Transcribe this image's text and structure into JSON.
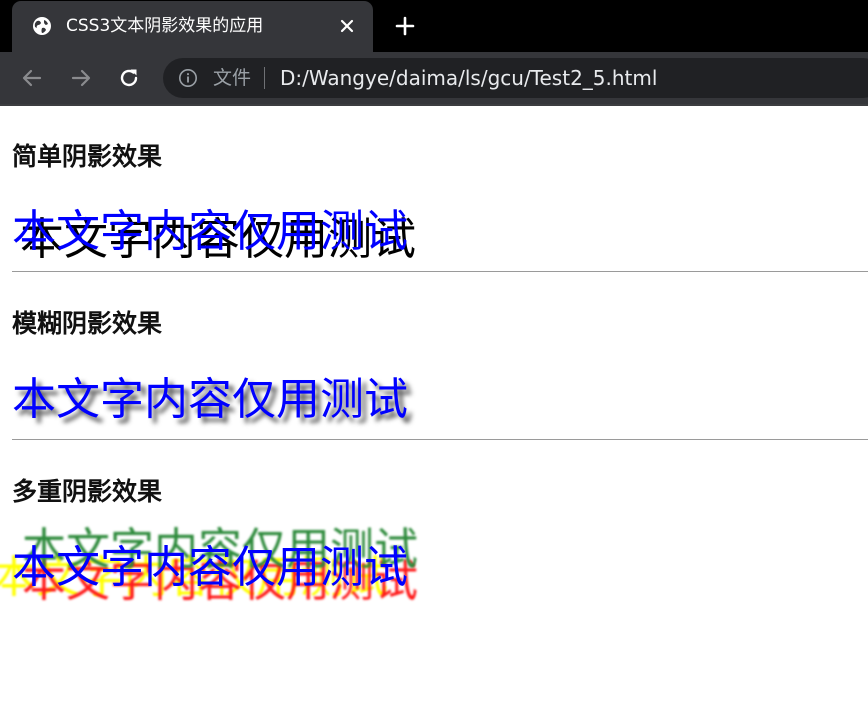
{
  "browser": {
    "tab": {
      "title": "CSS3文本阴影效果的应用",
      "favicon": "globe-icon"
    },
    "address_bar": {
      "scheme_label": "文件",
      "url": "D:/Wangye/daima/ls/gcu/Test2_5.html"
    }
  },
  "sections": [
    {
      "heading": "简单阴影效果",
      "sample_text": "本文字内容仅用测试"
    },
    {
      "heading": "模糊阴影效果",
      "sample_text": "本文字内容仅用测试"
    },
    {
      "heading": "多重阴影效果",
      "sample_text": "本文字内容仅用测试"
    }
  ],
  "colors": {
    "text": "#0000ff",
    "simple_shadow": "#000000",
    "blur_shadow": "#555555",
    "multi_shadows": [
      "#2e8b3c",
      "#ff1a1a",
      "#ffff00"
    ]
  }
}
